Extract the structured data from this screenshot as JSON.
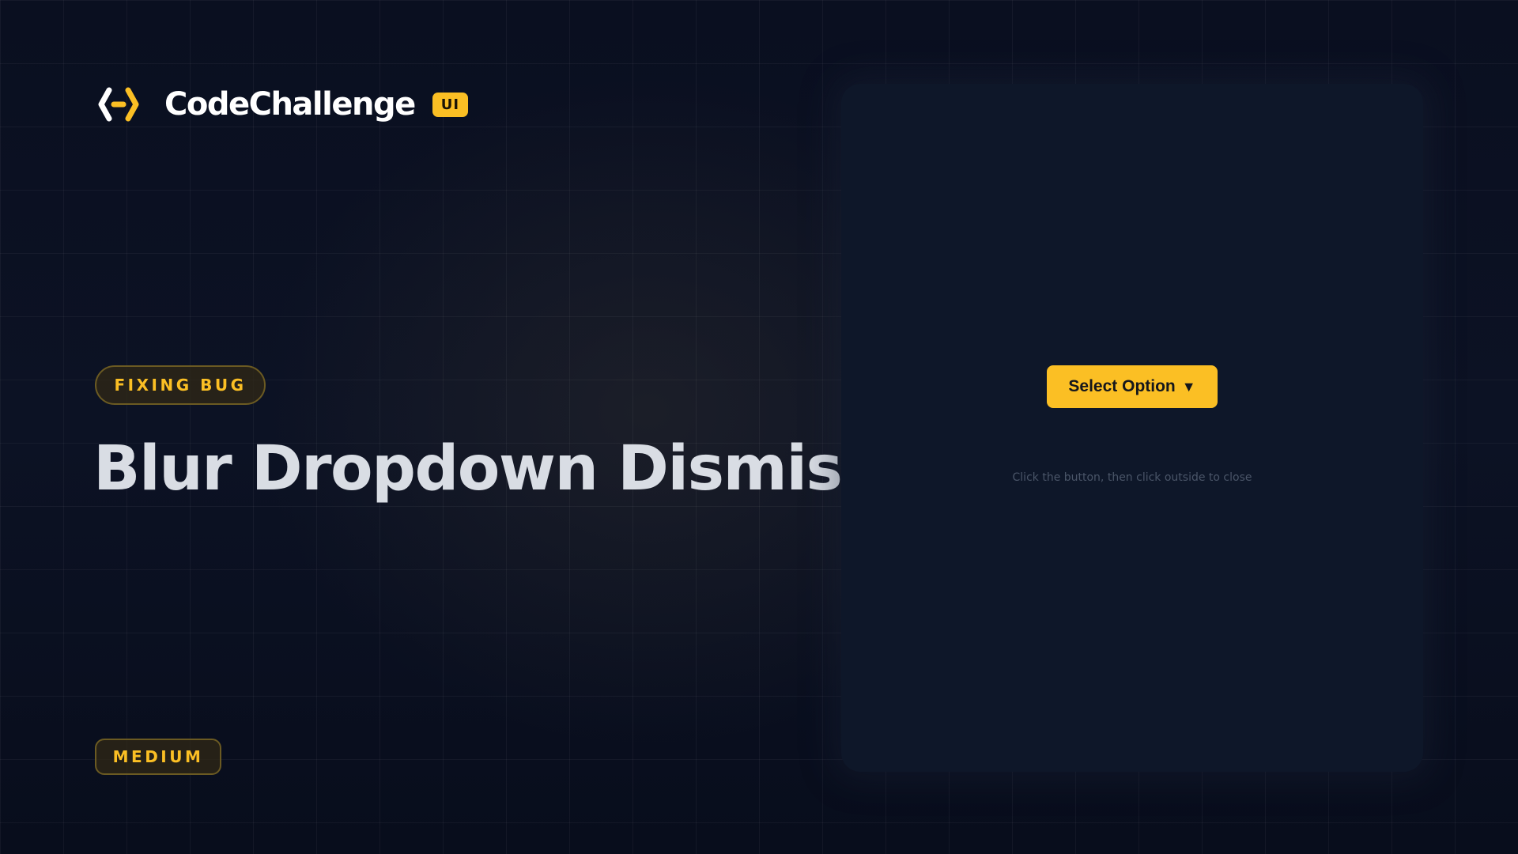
{
  "brand": {
    "name": "CodeChallenge",
    "badge": "UI",
    "logo_icon": "code-brackets-icon"
  },
  "challenge": {
    "category": "FIXING BUG",
    "title": "Blur Dropdown Dismiss",
    "difficulty": "MEDIUM"
  },
  "demo": {
    "button_label": "Select Option",
    "button_caret": "▼",
    "hint": "Click the button, then click outside to close"
  },
  "colors": {
    "accent": "#fbbf24",
    "background": "#0a0f1e",
    "panel": "#0e1729",
    "title": "#d9dde4"
  }
}
